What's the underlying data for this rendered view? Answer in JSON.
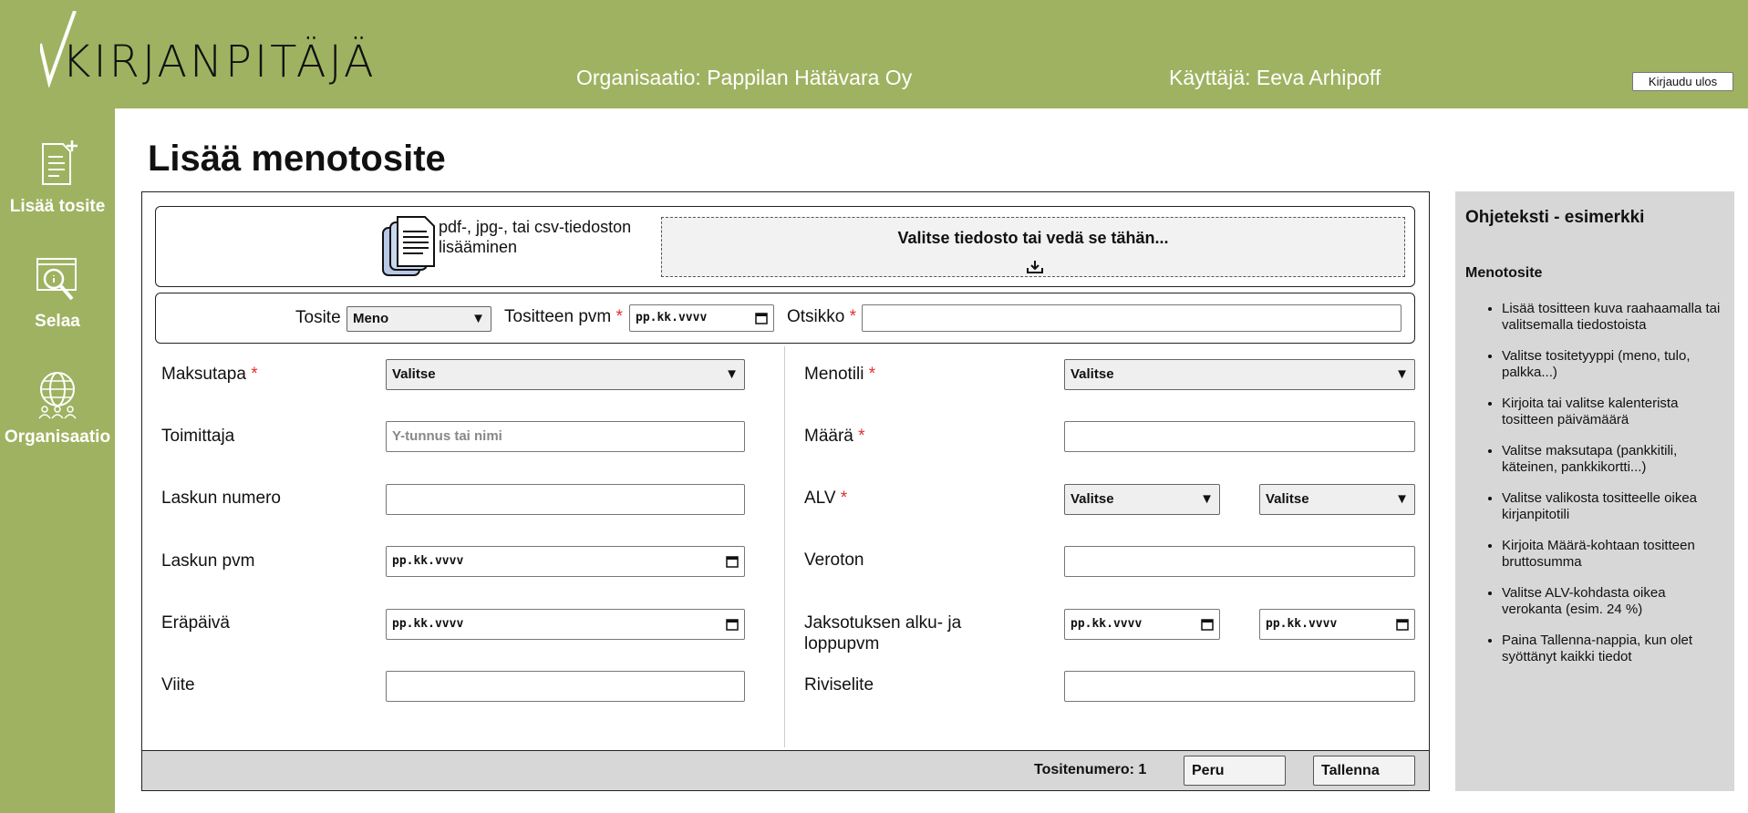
{
  "header": {
    "logo_text": "KIRJANPITÄJÄ",
    "organization": "Organisaatio: Pappilan Hätävara Oy",
    "user": "Käyttäjä: Eeva Arhipoff",
    "logout_label": "Kirjaudu ulos",
    "bg_color": "#9fb261"
  },
  "sidebar": {
    "items": [
      {
        "label": "Lisää tosite",
        "icon": "document-add-icon"
      },
      {
        "label": "Selaa",
        "icon": "browse-search-icon"
      },
      {
        "label": "Organisaatio",
        "icon": "globe-people-icon"
      }
    ]
  },
  "main": {
    "title": "Lisää menotosite",
    "upload": {
      "label": "pdf-, jpg-, tai csv-tiedoston lisääminen",
      "dropzone_text": "Valitse tiedosto tai vedä se tähän..."
    },
    "top": {
      "tosite_label": "Tosite",
      "tosite_value": "Meno",
      "pvm_label": "Tositteen pvm",
      "pvm_value": "pp.kk.vvvv",
      "otsikko_label": "Otsikko",
      "otsikko_value": "",
      "required_mark": "*"
    },
    "left": {
      "maksutapa_label": "Maksutapa",
      "maksutapa_value": "Valitse",
      "toimittaja_label": "Toimittaja",
      "toimittaja_placeholder": "Y-tunnus tai nimi",
      "laskun_numero_label": "Laskun numero",
      "laskun_pvm_label": "Laskun pvm",
      "laskun_pvm_value": "pp.kk.vvvv",
      "erapaiva_label": "Eräpäivä",
      "erapaiva_value": "pp.kk.vvvv",
      "viite_label": "Viite"
    },
    "right": {
      "menotili_label": "Menotili",
      "menotili_value": "Valitse",
      "maara_label": "Määrä",
      "alv_label": "ALV",
      "alv_value1": "Valitse",
      "alv_value2": "Valitse",
      "veroton_label": "Veroton",
      "jakso_label": "Jaksotuksen alku- ja loppupvm",
      "jakso_start": "pp.kk.vvvv",
      "jakso_end": "pp.kk.vvvv",
      "riviselite_label": "Riviselite"
    },
    "footer": {
      "tositenumero": "Tositenumero: 1",
      "cancel_label": "Peru",
      "save_label": "Tallenna"
    }
  },
  "help": {
    "title": "Ohjeteksti - esimerkki",
    "subtitle": "Menotosite",
    "items": [
      "Lisää tositteen kuva raahaamalla tai valitsemalla tiedostoista",
      "Valitse tositetyyppi (meno, tulo, palkka...)",
      "Kirjoita tai valitse kalenterista tositteen päivämäärä",
      "Valitse maksutapa (pankkitili, käteinen, pankkikortti...)",
      "Valitse valikosta tositteelle oikea kirjanpitotili",
      "Kirjoita Määrä-kohtaan tositteen bruttosumma",
      "Valitse ALV-kohdasta oikea verokanta (esim. 24 %)",
      "Paina Tallenna-nappia, kun olet syöttänyt kaikki tiedot"
    ]
  }
}
